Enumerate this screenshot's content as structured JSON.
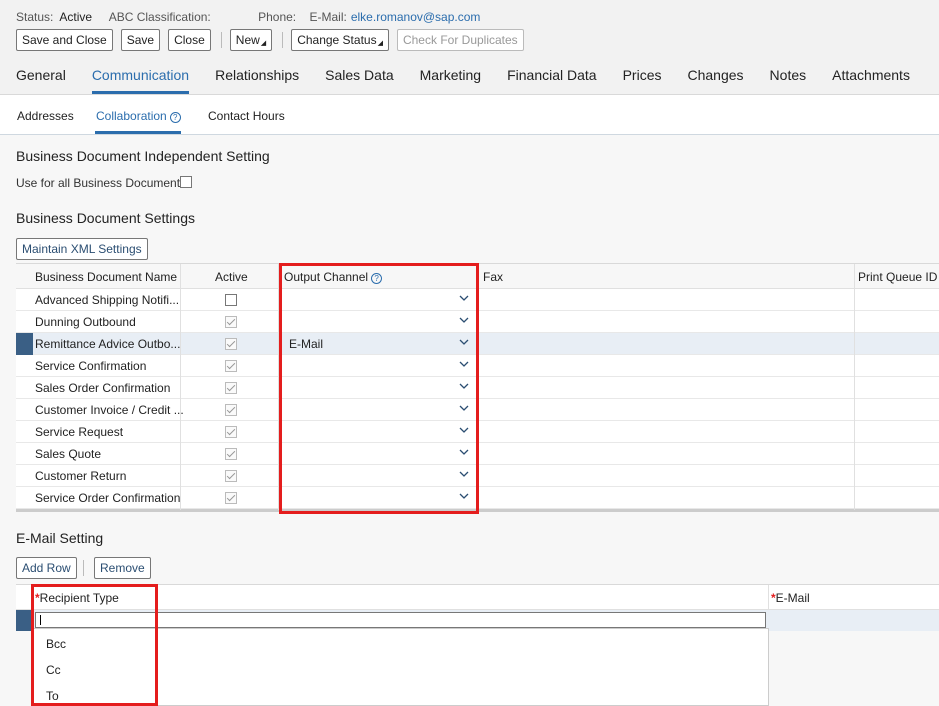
{
  "status_line": {
    "status_label": "Status:",
    "status_value": "Active",
    "abc_label": "ABC Classification:",
    "phone_label": "Phone:",
    "email_label": "E-Mail:",
    "email_value": "elke.romanov@sap.com"
  },
  "toolbar": {
    "save_close": "Save and Close",
    "save": "Save",
    "close": "Close",
    "new": "New",
    "change_status": "Change Status",
    "check_duplicates": "Check For Duplicates"
  },
  "tabs": [
    "General",
    "Communication",
    "Relationships",
    "Sales Data",
    "Marketing",
    "Financial Data",
    "Prices",
    "Changes",
    "Notes",
    "Attachments"
  ],
  "subtabs": [
    "Addresses",
    "Collaboration",
    "Contact Hours"
  ],
  "independent": {
    "title": "Business Document Independent Setting",
    "use_all": "Use for all Business Documents:"
  },
  "settings": {
    "title": "Business Document Settings",
    "maintain_xml": "Maintain XML Settings",
    "columns": {
      "name": "Business Document Name",
      "active": "Active",
      "channel": "Output Channel",
      "fax": "Fax",
      "print": "Print Queue ID"
    },
    "rows": [
      {
        "name": "Advanced Shipping Notifi...",
        "active": false,
        "channel": ""
      },
      {
        "name": "Dunning Outbound",
        "active": true,
        "channel": ""
      },
      {
        "name": "Remittance Advice Outbo...",
        "active": true,
        "channel": "E-Mail"
      },
      {
        "name": "Service Confirmation",
        "active": true,
        "channel": ""
      },
      {
        "name": "Sales Order Confirmation",
        "active": true,
        "channel": ""
      },
      {
        "name": "Customer Invoice / Credit ...",
        "active": true,
        "channel": ""
      },
      {
        "name": "Service Request",
        "active": true,
        "channel": ""
      },
      {
        "name": "Sales Quote",
        "active": true,
        "channel": ""
      },
      {
        "name": "Customer Return",
        "active": true,
        "channel": ""
      },
      {
        "name": "Service Order Confirmation",
        "active": true,
        "channel": ""
      }
    ]
  },
  "email_setting": {
    "title": "E-Mail Setting",
    "add_row": "Add Row",
    "remove": "Remove",
    "recipient_type": "Recipient Type",
    "email_col": "E-Mail",
    "required_mark": "*",
    "options": [
      "Bcc",
      "Cc",
      "To"
    ]
  },
  "colors": {
    "accent": "#2b6dad",
    "highlight": "#e41d1d",
    "row_marker": "#3a5f85"
  }
}
